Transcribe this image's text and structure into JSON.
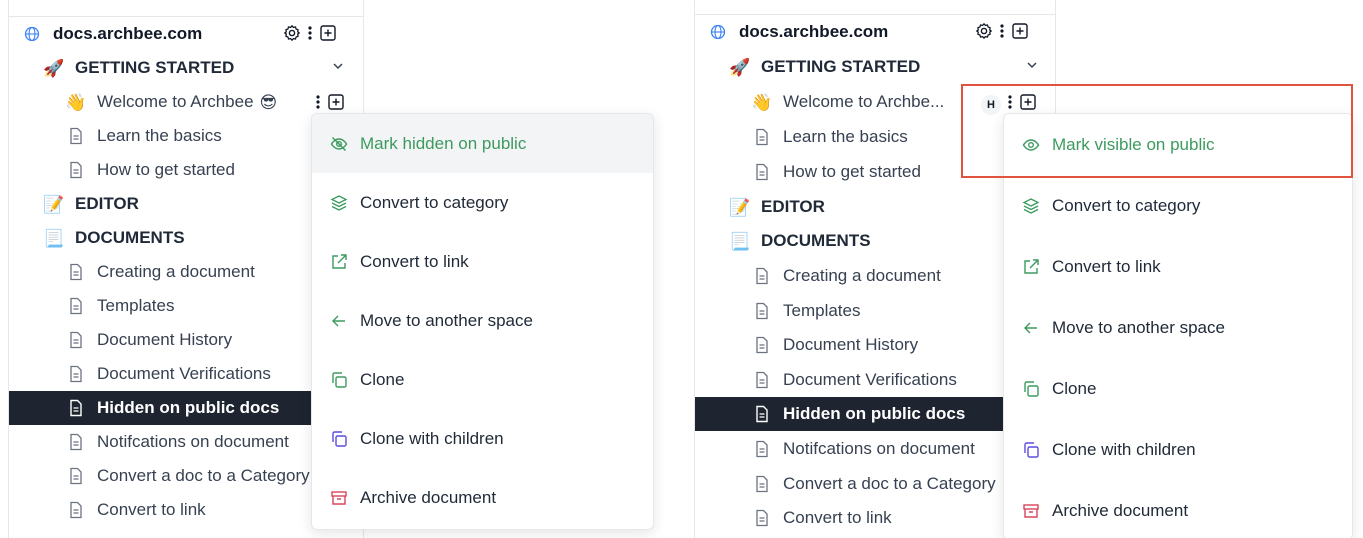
{
  "sidebar": {
    "space_title": "docs.archbee.com",
    "sections": {
      "getting_started": "GETTING STARTED",
      "editor": "EDITOR",
      "documents": "DOCUMENTS"
    },
    "welcome_label": "Welcome to Archbee",
    "welcome_label_truncated": "Welcome to Archbe...",
    "items": {
      "learn": "Learn the basics",
      "how": "How to get started",
      "creating": "Creating a document",
      "templates": "Templates",
      "history": "Document History",
      "verifications": "Document Verifications",
      "hidden": "Hidden on public docs",
      "notifications": "Notifcations on document",
      "convert_category": "Convert a doc to a Category",
      "convert_link": "Convert to link"
    },
    "hidden_badge": "H"
  },
  "menu": {
    "mark_hidden": "Mark hidden on public",
    "mark_visible": "Mark visible on public",
    "convert_category": "Convert to category",
    "convert_link": "Convert to link",
    "move": "Move to another space",
    "clone": "Clone",
    "clone_children": "Clone with children",
    "archive": "Archive document"
  },
  "colors": {
    "selected_bg": "#1e2531",
    "green": "#3c9a5f",
    "purple": "#5b4ce0",
    "red": "#d8455a",
    "highlight": "#e0533d"
  }
}
